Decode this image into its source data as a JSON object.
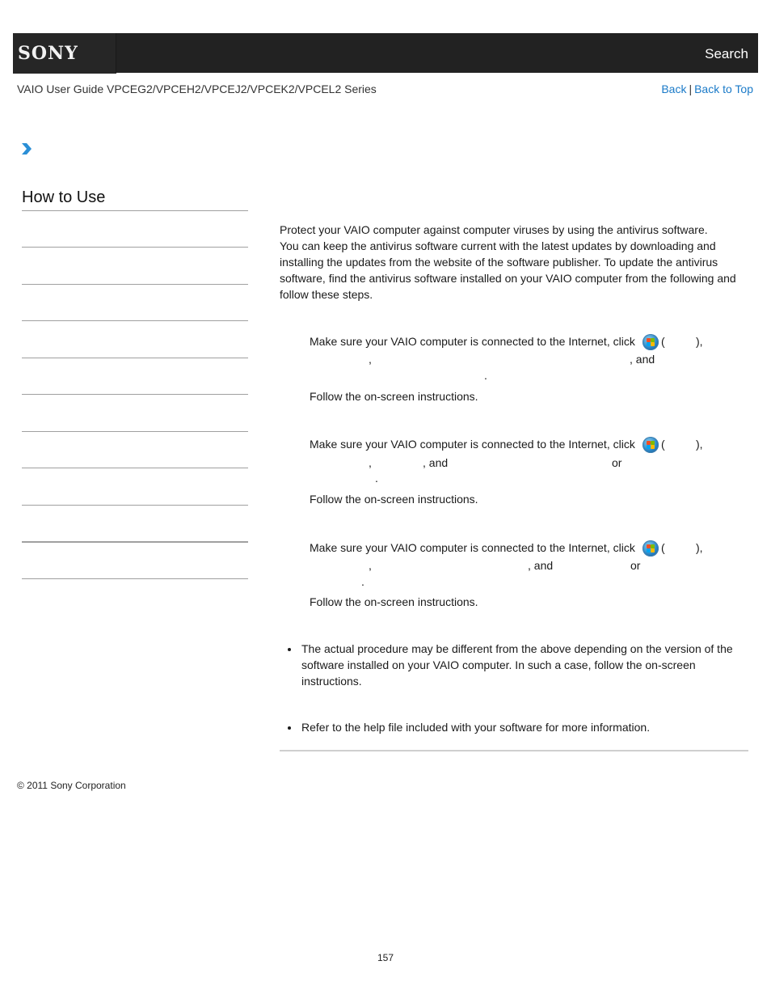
{
  "header": {
    "logo": "SONY",
    "search_label": "Search"
  },
  "subheader": {
    "guide_title": "VAIO User Guide VPCEG2/VPCEH2/VPCEJ2/VPCEK2/VPCEL2 Series",
    "back_label": "Back",
    "separator": "|",
    "back_to_top_label": "Back to Top"
  },
  "sidebar": {
    "title": "How to Use",
    "item_count": 10
  },
  "main": {
    "intro_lines": [
      "Protect your VAIO computer against computer viruses by using the antivirus software.",
      "You can keep the antivirus software current with the latest updates by downloading and",
      "installing the updates from the website of the software publisher. To update the antivirus",
      "software, find the antivirus software installed on your VAIO computer from the following and",
      "follow these steps."
    ],
    "sections": [
      {
        "step1_prefix": "Make sure your VAIO computer is connected to the Internet, click",
        "open_paren": "(",
        "close_paren": "),",
        "line2_fragments": [
          ",",
          ", and"
        ],
        "line3_fragment": ".",
        "step2": "Follow the on-screen instructions."
      },
      {
        "step1_prefix": "Make sure your VAIO computer is connected to the Internet, click",
        "open_paren": "(",
        "close_paren": "),",
        "line2_fragments": [
          ",",
          ", and",
          "or"
        ],
        "line3_fragment": ".",
        "step2": "Follow the on-screen instructions."
      },
      {
        "step1_prefix": "Make sure your VAIO computer is connected to the Internet, click",
        "open_paren": "(",
        "close_paren": "),",
        "line2_fragments": [
          ",",
          ", and",
          "or"
        ],
        "line3_fragment": ".",
        "step2": "Follow the on-screen instructions."
      }
    ],
    "notes": [
      "The actual procedure may be different from the above depending on the version of the software installed on your VAIO computer. In such a case, follow the on-screen instructions."
    ],
    "hints": [
      "Refer to the help file included with your software for more information."
    ],
    "start_icon": "windows-start-icon"
  },
  "footer": {
    "copyright": "© 2011 Sony Corporation",
    "page_number": "157"
  },
  "colors": {
    "header_bg": "#222222",
    "link": "#1a7ac8",
    "rule": "#a0a0a0"
  }
}
